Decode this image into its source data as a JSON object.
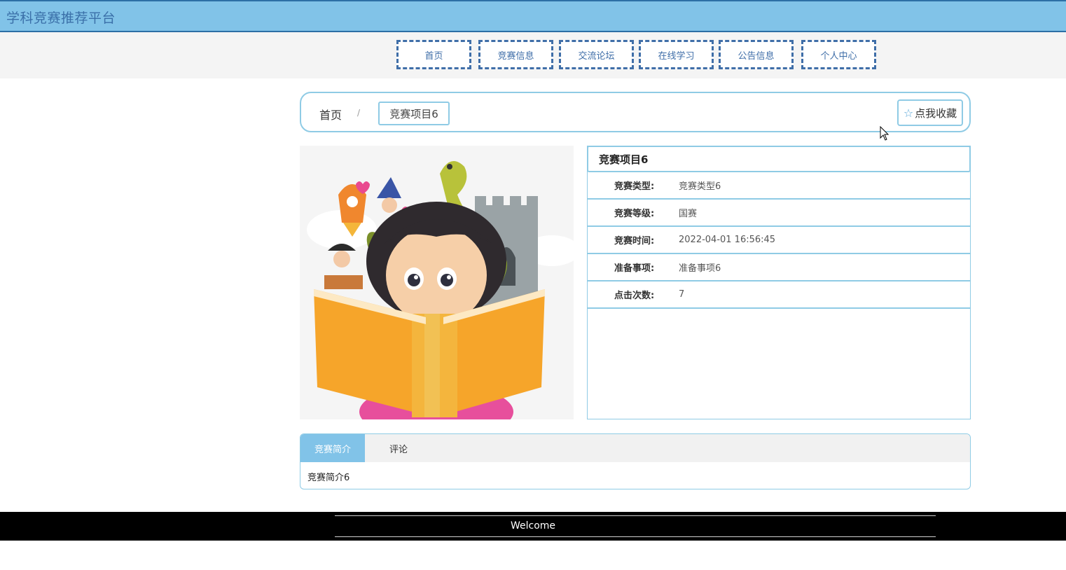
{
  "header": {
    "site_title": "学科竞赛推荐平台"
  },
  "nav": {
    "items": [
      {
        "label": "首页"
      },
      {
        "label": "竞赛信息"
      },
      {
        "label": "交流论坛"
      },
      {
        "label": "在线学习"
      },
      {
        "label": "公告信息"
      },
      {
        "label": "个人中心"
      }
    ]
  },
  "breadcrumb": {
    "home": "首页",
    "separator": "/",
    "current": "竞赛项目6"
  },
  "favorite": {
    "icon": "star-icon",
    "label": "点我收藏"
  },
  "detail": {
    "title": "竞赛项目6",
    "rows": [
      {
        "label": "竞赛类型:",
        "value": "竞赛类型6"
      },
      {
        "label": "竞赛等级:",
        "value": "国赛"
      },
      {
        "label": "竞赛时间:",
        "value": "2022-04-01 16:56:45"
      },
      {
        "label": "准备事项:",
        "value": "准备事项6"
      },
      {
        "label": "点击次数:",
        "value": "7"
      }
    ]
  },
  "tabs": {
    "items": [
      {
        "label": "竞赛简介",
        "active": true
      },
      {
        "label": "评论",
        "active": false
      }
    ],
    "content": "竞赛简介6"
  },
  "footer": {
    "text": "Welcome"
  },
  "colors": {
    "header_bg": "#81c3e8",
    "nav_border": "#3f6ea8",
    "accent_border": "#8fcbe5",
    "footer_bg": "#000000"
  }
}
